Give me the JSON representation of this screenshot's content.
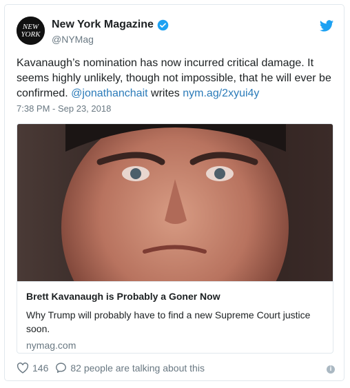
{
  "account": {
    "name": "New York Magazine",
    "handle": "@NYMag",
    "avatar_text": "NEW YORK"
  },
  "tweet": {
    "text_part1": "Kavanaugh’s nomination has now incurred critical damage. It seems highly unlikely, though not impossible, that he will ever be confirmed. ",
    "mention": "@jonathanchait",
    "text_part2": " writes ",
    "link": "nym.ag/2xyui4y",
    "timestamp": "7:38 PM - Sep 23, 2018"
  },
  "card": {
    "headline": "Brett Kavanaugh is Probably a Goner Now",
    "description": "Why Trump will probably have to find a new Supreme Court justice soon.",
    "domain": "nymag.com"
  },
  "footer": {
    "likes": "146",
    "talking": "82 people are talking about this"
  },
  "colors": {
    "link": "#2b7bb9",
    "verified": "#1da1f2",
    "twitter_bird": "#1da1f2",
    "muted": "#697882"
  }
}
